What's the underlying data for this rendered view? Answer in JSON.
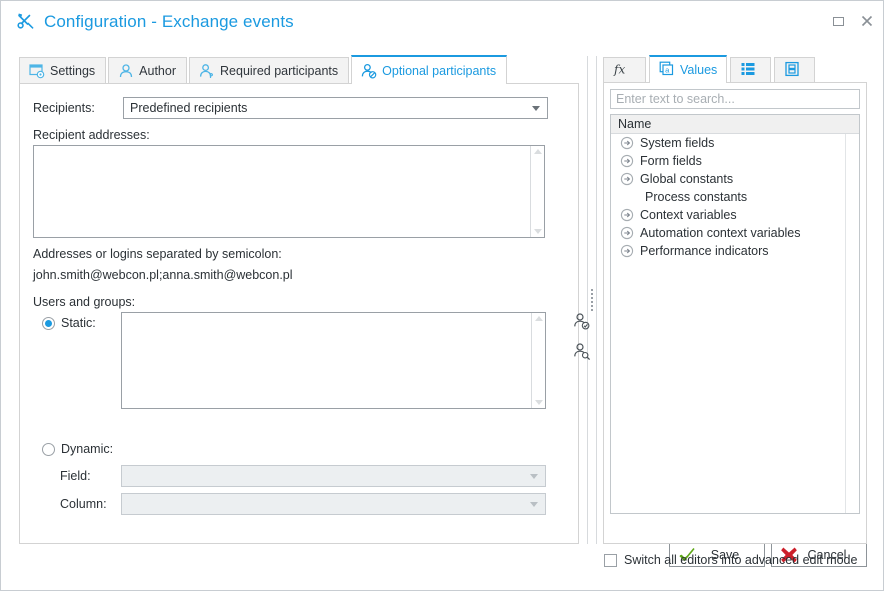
{
  "window": {
    "title": "Configuration - Exchange events",
    "icon": "tools-icon",
    "controls": {
      "maximize": "maximize-icon",
      "close": "close-icon"
    },
    "accent_color": "#1b9ae0"
  },
  "tabs": [
    {
      "label": "Settings",
      "icon": "window-settings-icon",
      "active": false
    },
    {
      "label": "Author",
      "icon": "person-icon",
      "active": false
    },
    {
      "label": "Required participants",
      "icon": "person-required-icon",
      "active": false
    },
    {
      "label": "Optional participants",
      "icon": "person-optional-icon",
      "active": true
    }
  ],
  "form": {
    "recipients_label": "Recipients:",
    "recipients_value": "Predefined recipients",
    "recipient_addresses_label": "Recipient addresses:",
    "recipient_addresses_value": "",
    "hint_line1": "Addresses or logins separated by semicolon:",
    "hint_line2": "john.smith@webcon.pl;anna.smith@webcon.pl",
    "users_groups_label": "Users and groups:",
    "static_label": "Static:",
    "static_value": "",
    "static_selected": true,
    "dynamic_label": "Dynamic:",
    "dynamic_selected": false,
    "field_label": "Field:",
    "field_value": "",
    "column_label": "Column:",
    "column_value": "",
    "picker_icons": [
      "person-check-icon",
      "person-search-icon"
    ]
  },
  "right_panel": {
    "tabs": [
      {
        "label": "",
        "icon": "function-fx-icon",
        "active": false
      },
      {
        "label": "Values",
        "icon": "values-a-icon",
        "active": true
      },
      {
        "label": "",
        "icon": "list-grid-icon",
        "active": false
      },
      {
        "label": "",
        "icon": "panel-icon",
        "active": false
      }
    ],
    "search_placeholder": "Enter text to search...",
    "search_value": "",
    "tree_header": "Name",
    "tree_items": [
      {
        "label": "System fields",
        "expandable": true
      },
      {
        "label": "Form fields",
        "expandable": true
      },
      {
        "label": "Global constants",
        "expandable": true
      },
      {
        "label": "Process constants",
        "expandable": false
      },
      {
        "label": "Context variables",
        "expandable": true
      },
      {
        "label": "Automation context variables",
        "expandable": true
      },
      {
        "label": "Performance indicators",
        "expandable": true
      }
    ],
    "advanced_checkbox_label": "Switch all editors into advanced edit mode",
    "advanced_checkbox_checked": false
  },
  "footer": {
    "save_label": "Save",
    "save_icon": "green-check-icon",
    "cancel_label": "Cancel",
    "cancel_icon": "red-x-icon"
  }
}
